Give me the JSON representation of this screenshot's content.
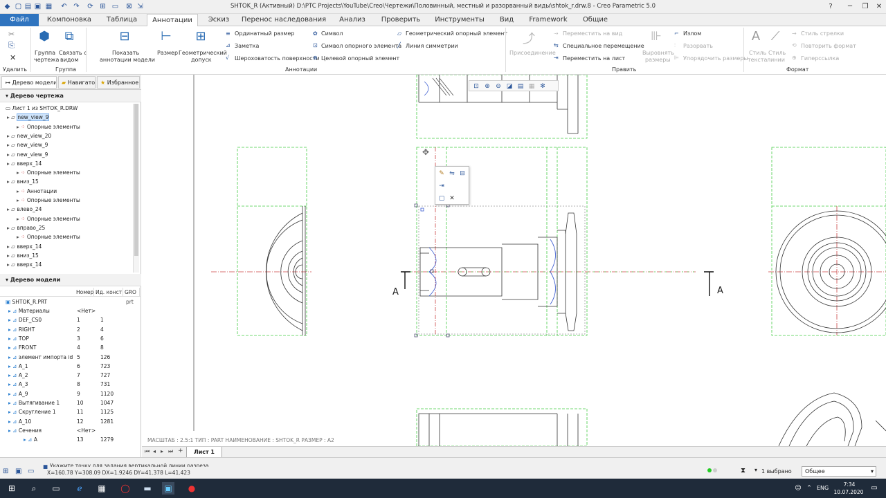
{
  "window": {
    "title": "SHTOK_R (Активный) D:\\PTC Projects\\YouTube\\Creo\\Чертежи\\Половинный, местный и разорванный виды\\shtok_r.drw.8 - Creo Parametric 5.0"
  },
  "tabs": [
    {
      "label": "Файл"
    },
    {
      "label": "Компоновка"
    },
    {
      "label": "Таблица"
    },
    {
      "label": "Аннотации"
    },
    {
      "label": "Эскиз"
    },
    {
      "label": "Перенос наследования"
    },
    {
      "label": "Анализ"
    },
    {
      "label": "Проверить"
    },
    {
      "label": "Инструменты"
    },
    {
      "label": "Вид"
    },
    {
      "label": "Framework"
    },
    {
      "label": "Общие"
    }
  ],
  "ribbon": {
    "delete": "Удалить",
    "group_label": "Группа",
    "group_drawing_1": "Группа",
    "group_drawing_2": "чертежа",
    "link_view_1": "Связать с",
    "link_view_2": "видом",
    "show_ann_1": "Показать",
    "show_ann_2": "аннотации модели",
    "dimension": "Размер",
    "geo_tol_1": "Геометрический",
    "geo_tol_2": "допуск",
    "ordinate": "Ординатный размер",
    "note": "Заметка",
    "roughness": "Шероховатость поверхности",
    "symbol": "Символ",
    "datum_symbol": "Символ опорного элемента",
    "datum_target": "Целевой опорный элемент",
    "geo_datum": "Геометрический опорный элемент",
    "sym_line": "Линия симметрии",
    "annotations_label": "Аннотации",
    "attach": "Присоединение",
    "move_to_view": "Переместить на вид",
    "special_move": "Специальное перемещение",
    "move_to_sheet": "Переместить на лист",
    "align_dims_1": "Выровнять",
    "align_dims_2": "размеры",
    "jog": "Излом",
    "break": "Разорвать",
    "arrange_dims": "Упорядочить размеры",
    "edit_label": "Править",
    "text_style_1": "Стиль",
    "text_style_2": "текста",
    "line_style_1": "Стиль",
    "line_style_2": "линии",
    "arrow_style": "Стиль стрелки",
    "repeat_format": "Повторить формат",
    "hyperlink": "Гиперссылка",
    "format_label": "Формат"
  },
  "panel": {
    "tab_model_tree": "Дерево модели",
    "tab_navigator": "Навигатор",
    "tab_favorites": "Избранное",
    "drawing_tree_title": "Дерево чертежа",
    "drawing_tree": [
      {
        "label": "Лист 1 из SHTOK_R.DRW",
        "indent": 0
      },
      {
        "label": "new_view_9",
        "indent": 1
      },
      {
        "label": "Опорные элементы",
        "indent": 2
      },
      {
        "label": "new_view_20",
        "indent": 1
      },
      {
        "label": "new_view_9",
        "indent": 1
      },
      {
        "label": "new_view_9",
        "indent": 1
      },
      {
        "label": "вверх_14",
        "indent": 1
      },
      {
        "label": "Опорные элементы",
        "indent": 2
      },
      {
        "label": "вниз_15",
        "indent": 1
      },
      {
        "label": "Аннотации",
        "indent": 2
      },
      {
        "label": "Опорные элементы",
        "indent": 2
      },
      {
        "label": "влево_24",
        "indent": 1
      },
      {
        "label": "Опорные элементы",
        "indent": 2
      },
      {
        "label": "вправо_25",
        "indent": 1
      },
      {
        "label": "Опорные элементы",
        "indent": 2
      },
      {
        "label": "вверх_14",
        "indent": 1
      },
      {
        "label": "вниз_15",
        "indent": 1
      },
      {
        "label": "вверх_14",
        "indent": 1
      }
    ],
    "model_tree_title": "Дерево модели",
    "columns": [
      "Номер",
      "Ид. конст",
      "GRO"
    ],
    "model_root": "SHTOK_R.PRT",
    "model_root_ext": "prt",
    "model_tree": [
      {
        "name": "Материалы",
        "num": "<Нет>",
        "id": ""
      },
      {
        "name": "DEF_CS0",
        "num": "1",
        "id": "1"
      },
      {
        "name": "RIGHT",
        "num": "2",
        "id": "4"
      },
      {
        "name": "TOP",
        "num": "3",
        "id": "6"
      },
      {
        "name": "FRONT",
        "num": "4",
        "id": "8"
      },
      {
        "name": "элемент импорта id",
        "num": "5",
        "id": "126"
      },
      {
        "name": "A_1",
        "num": "6",
        "id": "723"
      },
      {
        "name": "A_2",
        "num": "7",
        "id": "727"
      },
      {
        "name": "A_3",
        "num": "8",
        "id": "731"
      },
      {
        "name": "A_9",
        "num": "9",
        "id": "1120"
      },
      {
        "name": "Вытягивание 1",
        "num": "10",
        "id": "1047"
      },
      {
        "name": "Скругление 1",
        "num": "11",
        "id": "1125"
      },
      {
        "name": "A_10",
        "num": "12",
        "id": "1281"
      },
      {
        "name": "Сечения",
        "num": "<Нет>",
        "id": ""
      },
      {
        "name": "A",
        "num": "13",
        "id": "1279"
      }
    ]
  },
  "canvas": {
    "scale_info": "МАСШТАБ : 2.5:1     ТИП : PART     НАИМЕНОВАНИЕ : SHTOK_R     РАЗМЕР : A2",
    "section_label_left": "A",
    "section_label_right": "A"
  },
  "sheet_tab": "Лист 1",
  "status": {
    "message": "Укажите точку для задания вертикальной линии разреза",
    "coords": "X=160.78 Y=308.09 DX=1.9246 DY=41.378 L=41.423",
    "selected": "1 выбрано",
    "filter": "Общее"
  },
  "taskbar": {
    "lang": "ENG",
    "time": "7:34",
    "date": "10.07.2020"
  }
}
